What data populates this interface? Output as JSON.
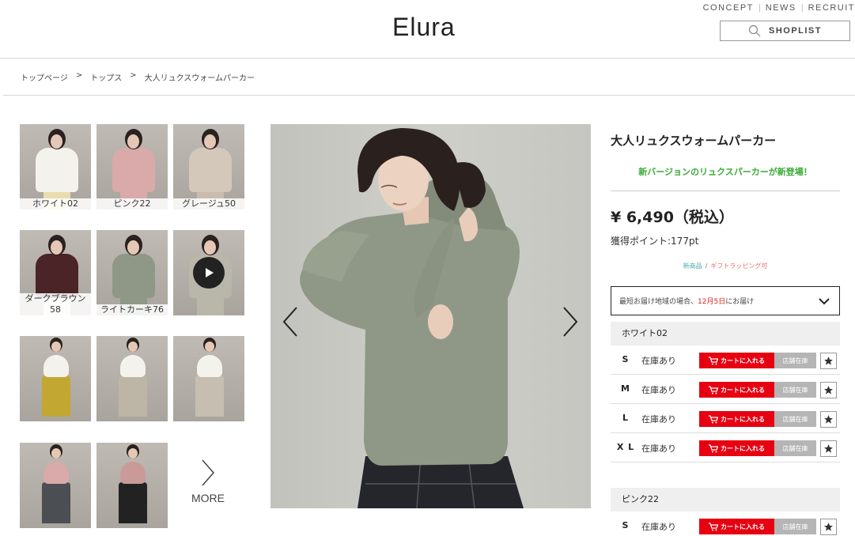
{
  "header": {
    "logo": "Elura",
    "nav": [
      "CONCEPT",
      "NEWS",
      "RECRUIT"
    ],
    "shoplist_label": "SHOPLIST"
  },
  "breadcrumb": [
    "トップページ",
    "トップス",
    "大人リュクスウォームパーカー"
  ],
  "breadcrumb_sep": ">",
  "thumbnails": [
    {
      "label": "ホワイト02",
      "top": "#f4f2ec",
      "bottom": "#e9dcae"
    },
    {
      "label": "ピンク22",
      "top": "#d9aaa9",
      "bottom": "#d9aaa9"
    },
    {
      "label": "グレージュ50",
      "top": "#d4c8bb",
      "bottom": "#c9bcae"
    },
    {
      "label": "ダークブラウン58",
      "top": "#4a2426",
      "bottom": "#efe8dc"
    },
    {
      "label": "ライトカーキ76",
      "top": "#8f9886",
      "bottom": "#8f9886"
    },
    {
      "label": "",
      "top": "#b9b6aa",
      "bottom": "#b9b6aa",
      "video": true
    },
    {
      "label": "",
      "top": "#f4f2ec",
      "bottom": "#c2a832"
    },
    {
      "label": "",
      "top": "#f4f2ec",
      "bottom": "#bdb6a7"
    },
    {
      "label": "",
      "top": "#f4f2ec",
      "bottom": "#c6bfb1"
    },
    {
      "label": "",
      "top": "#d9aaa9",
      "bottom": "#4b4e52"
    },
    {
      "label": "",
      "top": "#c99a98",
      "bottom": "#222222"
    }
  ],
  "more_label": "MORE",
  "product": {
    "title": "大人リュクスウォームパーカー",
    "catch": "新バージョンのリュクスパーカーが新登場！",
    "price": "¥ 6,490（税込）",
    "points": "獲得ポイント:177pt",
    "tag_new": "新商品",
    "tag_gift": "ギフトラッピング可",
    "tag_sep": "/"
  },
  "delivery": {
    "prefix": "最短お届け地域の場合、",
    "date": "12月5日",
    "suffix": "にお届け"
  },
  "buttons": {
    "cart": "カートに入れる",
    "store": "店舗在庫"
  },
  "colors": [
    {
      "name": "ホワイト02",
      "sizes": [
        {
          "size": "S",
          "stock": "在庫あり"
        },
        {
          "size": "M",
          "stock": "在庫あり"
        },
        {
          "size": "L",
          "stock": "在庫あり"
        },
        {
          "size": "X L",
          "stock": "在庫あり"
        }
      ]
    },
    {
      "name": "ピンク22",
      "sizes": [
        {
          "size": "S",
          "stock": "在庫あり"
        }
      ]
    }
  ],
  "theme": {
    "cart_red": "#e60012",
    "catch_green": "#3aaa35",
    "sweater_khaki": "#8f9886"
  }
}
